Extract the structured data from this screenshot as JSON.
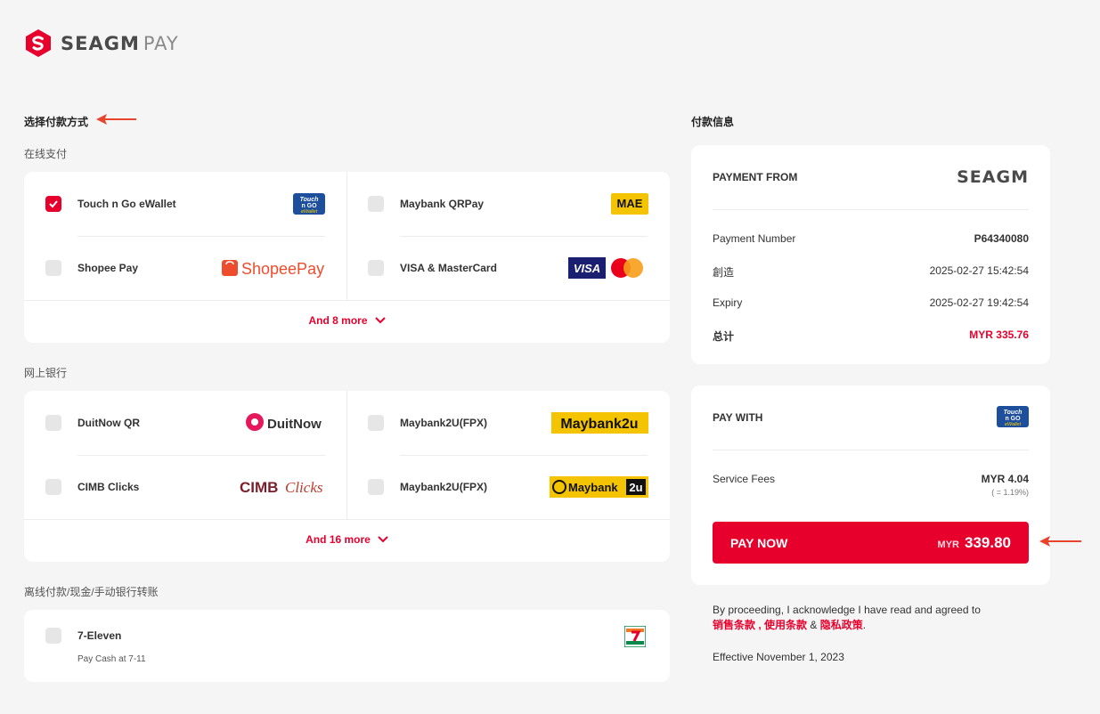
{
  "brand": {
    "name": "SEAGM",
    "suffix": "PAY"
  },
  "left": {
    "heading": "选择付款方式",
    "groups": [
      {
        "title": "在线支付",
        "options": [
          {
            "label": "Touch n Go eWallet",
            "checked": true,
            "logo": "touch-n-go-logo"
          },
          {
            "label": "Maybank QRPay",
            "checked": false,
            "logo": "mae-logo"
          },
          {
            "label": "Shopee Pay",
            "checked": false,
            "logo": "shopeepay-logo"
          },
          {
            "label": "VISA & MasterCard",
            "checked": false,
            "logo": "visa-mastercard-logo"
          }
        ],
        "more": "And 8 more"
      },
      {
        "title": "网上银行",
        "options": [
          {
            "label": "DuitNow QR",
            "checked": false,
            "logo": "duitnow-logo"
          },
          {
            "label": "Maybank2U(FPX)",
            "checked": false,
            "logo": "maybank2u-logo"
          },
          {
            "label": "CIMB Clicks",
            "checked": false,
            "logo": "cimb-clicks-logo"
          },
          {
            "label": "Maybank2U(FPX)",
            "checked": false,
            "logo": "maybank-2u-fpx-logo"
          }
        ],
        "more": "And 16 more"
      },
      {
        "title": "离线付款/现金/手动银行转账",
        "options": [
          {
            "label": "7-Eleven",
            "sub": "Pay Cash at 7-11",
            "checked": false,
            "logo": "seven-eleven-logo"
          }
        ]
      }
    ],
    "logo_text": {
      "tng_top": "Touch",
      "tng_mid": "n GO",
      "tng_bot": "eWallet",
      "mae": "MAE",
      "shopee": "ShopeePay",
      "visa": "VISA",
      "duitnow": "DuitNow",
      "maybank2u": "Maybank2u",
      "cimb": "CIMB",
      "clicks": "Clicks",
      "maybank": "Maybank",
      "m2u": "2u"
    }
  },
  "right": {
    "heading": "付款信息",
    "payment_from": {
      "title": "PAYMENT FROM",
      "merchant": "SEAGM",
      "rows": [
        {
          "label": "Payment Number",
          "value": "P64340080",
          "strong": true
        },
        {
          "label": "創造",
          "value": "2025-02-27 15:42:54"
        },
        {
          "label": "Expiry",
          "value": "2025-02-27 19:42:54"
        },
        {
          "label": "总计",
          "value": "MYR 335.76",
          "total": true
        }
      ]
    },
    "pay_with": {
      "title": "PAY WITH",
      "service_fees_label": "Service Fees",
      "service_fees_value": "MYR 4.04",
      "service_fees_rate": "( = 1.19%)",
      "pay_now_label": "PAY NOW",
      "pay_now_currency": "MYR",
      "pay_now_amount": "339.80"
    },
    "legal": {
      "prefix": "By proceeding, I acknowledge I have read and agreed to",
      "terms": "销售条款",
      "sep": " , ",
      "terms2": "使用条款",
      "amp": " & ",
      "privacy": "隐私政策",
      "end": ".",
      "effective": "Effective November 1, 2023"
    }
  },
  "colors": {
    "accent": "#e8002d",
    "bg": "#f5f5f5",
    "card": "#ffffff"
  }
}
